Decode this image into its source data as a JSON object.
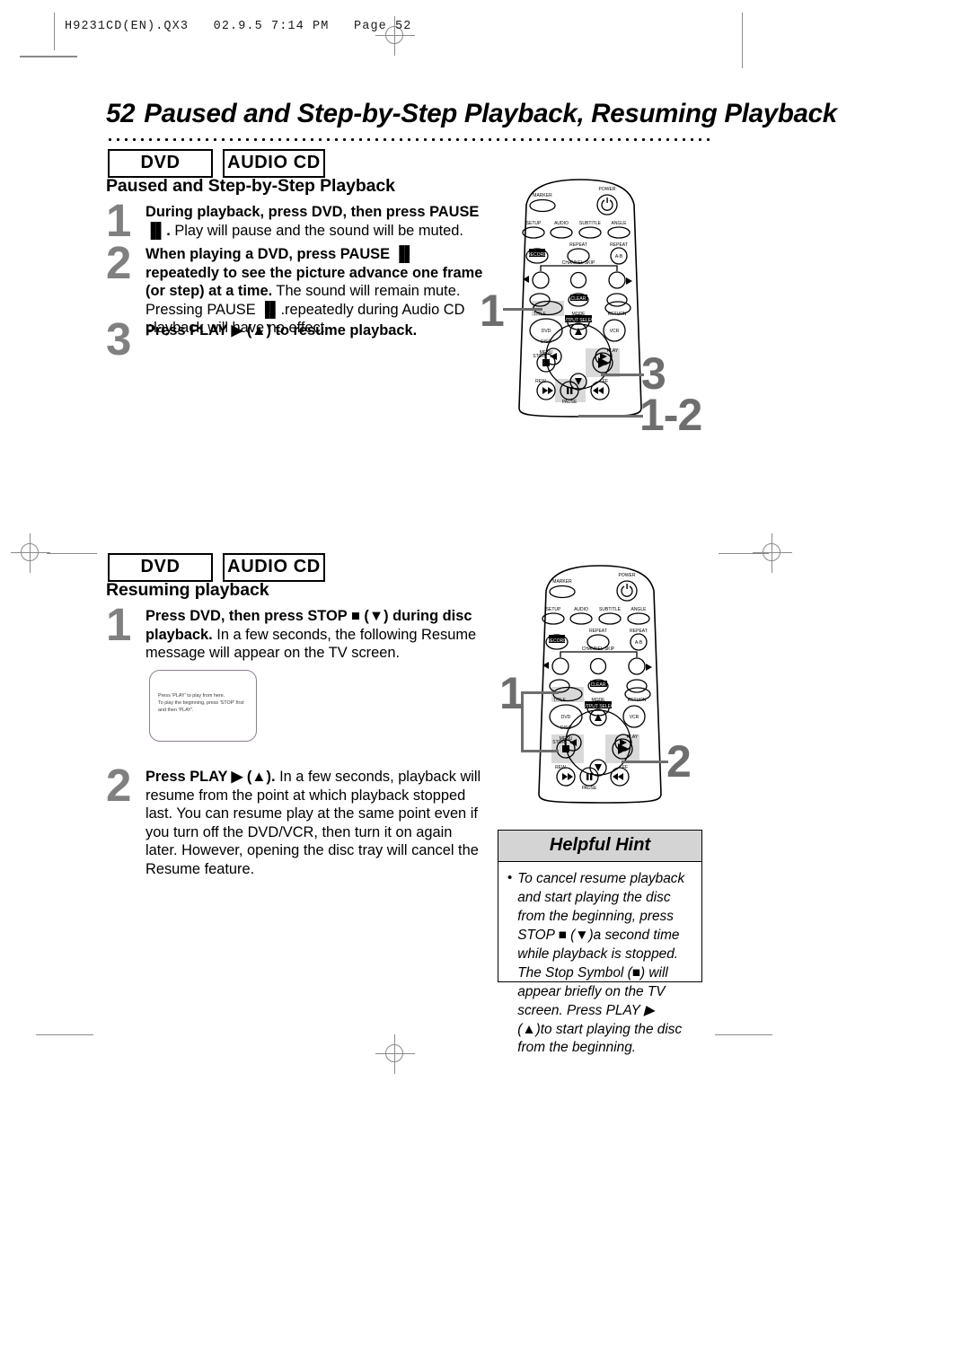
{
  "printer": {
    "slug": "H9231CD(EN).QX3   02.9.5 7:14 PM   Page 52"
  },
  "page": {
    "number": "52",
    "title": "Paused and Step-by-Step Playback, Resuming Playback"
  },
  "sections": [
    {
      "badges": [
        "DVD",
        "AUDIO CD"
      ],
      "heading": "Paused and Step-by-Step Playback",
      "steps": [
        {
          "number": "1",
          "bold": "During playback, press DVD, then press PAUSE ▐▌.",
          "rest": " Play will pause and the sound will be muted."
        },
        {
          "number": "2",
          "bold": "When playing a DVD, press PAUSE ▐▌ repeatedly to see the picture advance one frame (or step) at a time.",
          "rest": " The sound will remain mute. Pressing PAUSE ▐▌.repeatedly during Audio CD playback will have no effect."
        },
        {
          "number": "3",
          "bold": "Press PLAY ▶ (▲) to resume playback.",
          "rest": ""
        }
      ],
      "callouts": [
        "1",
        "3",
        "1-2"
      ]
    },
    {
      "badges": [
        "DVD",
        "AUDIO CD"
      ],
      "heading": "Resuming playback",
      "steps": [
        {
          "number": "1",
          "bold": "Press DVD, then press STOP ■ (▼) during disc playback.",
          "rest": " In a few seconds, the following Resume message will appear on the TV screen."
        },
        {
          "number": "2",
          "bold": "Press PLAY ▶ (▲).",
          "rest": " In a few seconds, playback will resume from the point at which playback stopped last. You can resume play at the same point even if you turn off the DVD/VCR, then turn it on again later. However, opening the disc tray will cancel the Resume feature."
        }
      ],
      "callouts": [
        "1",
        "2"
      ]
    }
  ],
  "tv_screen": {
    "line1": "Press 'PLAY' to play from here.",
    "line2": "To play the beginning, press 'STOP' first",
    "line3": "and then 'PLAY'."
  },
  "helpful_hint": {
    "title": "Helpful Hint",
    "bullet": "•",
    "text": "To cancel resume playback and start playing the disc from the beginning, press STOP ■ (▼)a second time while playback is stopped. The Stop Symbol (■) will appear briefly on the TV screen. Press PLAY ▶ (▲)to start playing the disc from the beginning."
  },
  "remote": {
    "buttons": {
      "marker": "MARKER",
      "power": "POWER",
      "setup": "SETUP",
      "audio": "AUDIO",
      "subtitle": "SUBTITLE",
      "angle": "ANGLE",
      "record": "RECORD",
      "repeat": "REPEAT",
      "repeat_ab_label": "REPEAT",
      "repeat_ab": "A-B",
      "channel_skip": "CHANNEL SKIP",
      "skip_prev": "◀◀",
      "clear": "CLEAR",
      "skip_next": "▶▶",
      "title": "TITLE",
      "mode": "MODE",
      "return": "RETURN",
      "output_select": "OUTPUT SELECT",
      "dvd": "DVD",
      "vcr": "VCR",
      "disc": "DISC",
      "menu": "MENU",
      "ok": "OK",
      "stop": "STOP",
      "play": "PLAY",
      "rew": "REW",
      "pause": "PAUSE",
      "ff": "FF"
    }
  },
  "colors": {
    "step_number": "#808080",
    "callout": "#6e6e6e",
    "hint_header_bg": "#d4d4d4",
    "highlight": "#d9d9d9",
    "tv_border": "#8e7d93",
    "crop_mark": "#8a8a8a"
  }
}
